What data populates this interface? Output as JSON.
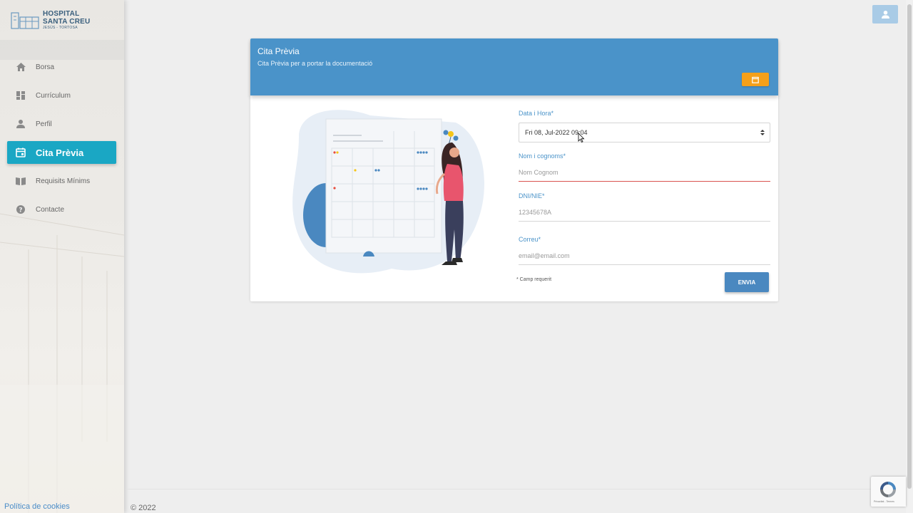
{
  "logo": {
    "line1": "HOSPITAL",
    "line2": "SANTA CREU",
    "line3": "JESÚS - TORTOSA"
  },
  "nav": {
    "items": [
      {
        "label": "Borsa",
        "icon": "home-icon"
      },
      {
        "label": "Currículum",
        "icon": "dashboard-icon"
      },
      {
        "label": "Perfil",
        "icon": "person-icon"
      },
      {
        "label": "Cita Prèvia",
        "icon": "calendar-icon",
        "active": true
      },
      {
        "label": "Requisits Mínims",
        "icon": "book-icon"
      },
      {
        "label": "Contacte",
        "icon": "help-icon"
      }
    ]
  },
  "footer": {
    "cookies": "Política de cookies",
    "copyright": "© 2022"
  },
  "card": {
    "title": "Cita Prèvia",
    "subtitle": "Cita Prèvia per a portar la documentació",
    "calendar_button_icon": "calendar-icon"
  },
  "form": {
    "datetime_label": "Data i Hora*",
    "datetime_value": "Fri 08, Jul-2022 09:04",
    "name_label": "Nom i cognoms*",
    "name_placeholder": "Nom Cognom",
    "dni_label": "DNI/NIE*",
    "dni_placeholder": "12345678A",
    "email_label": "Correu*",
    "email_placeholder": "email@email.com",
    "required_note": "* Camp requerit",
    "submit_label": "ENVIA"
  },
  "recaptcha": {
    "text": "Privacitat - Termes"
  },
  "colors": {
    "header_blue": "#4a93c9",
    "active_nav": "#1aa7c4",
    "accent_orange": "#f5a01a",
    "error_red": "#d9534f"
  }
}
